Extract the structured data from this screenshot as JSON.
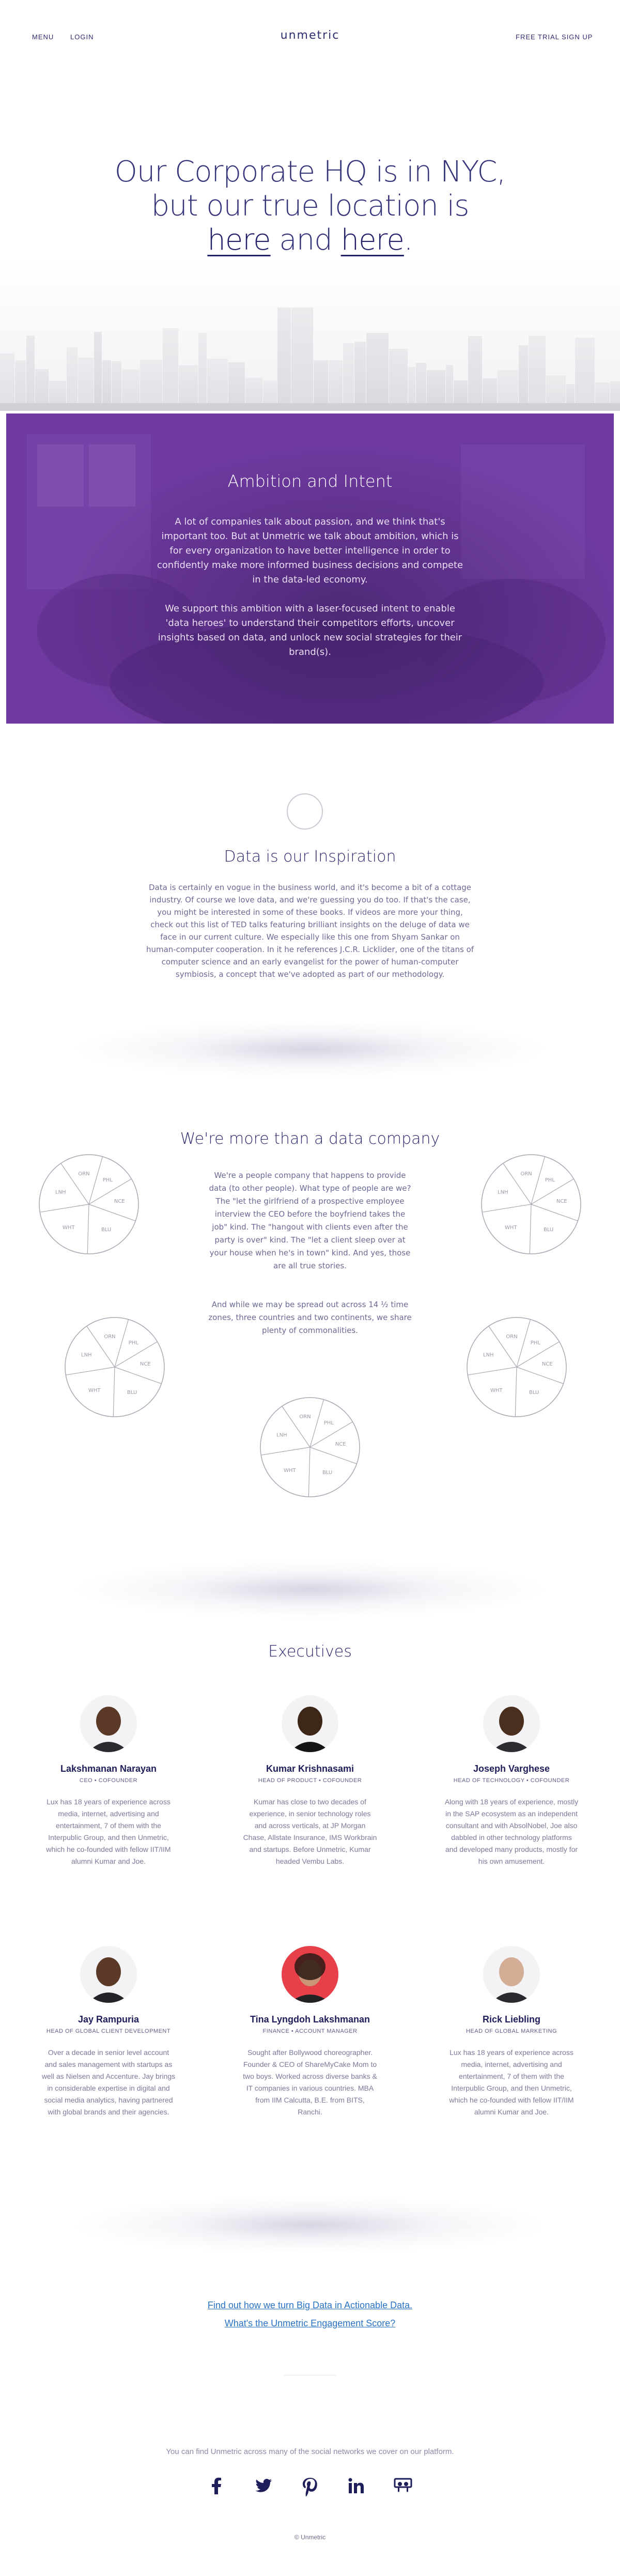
{
  "nav": {
    "menu": "MENU",
    "login": "LOGIN",
    "logo": "unmetric",
    "trial": "FREE TRIAL SIGN UP"
  },
  "hero": {
    "line1": "Our Corporate HQ is in NYC,",
    "line2": "but our true location is",
    "here1": "here",
    "and": "and",
    "here2": "here",
    "period": "."
  },
  "ambition": {
    "title": "Ambition and Intent",
    "p1": "A lot of companies talk about passion, and we think that's important too. But at Unmetric we talk about ambition, which is for every organization to have better intelligence in order to confidently make more informed business decisions and compete in the data-led economy.",
    "p2": "We support this ambition with a laser-focused intent to enable 'data heroes' to understand their competitors efforts, uncover insights based on data, and unlock new social strategies for their brand(s)."
  },
  "inspiration": {
    "title": "Data is our Inspiration",
    "text_a": "Data is certainly en vogue in the business world, and it's become a bit of a cottage industry. Of course we love data, and we're guessing you do too. If that's the case, you might be interested in some of these books. If videos are more your thing, check out this list of TED talks featuring brilliant insights on the deluge of data we face in our current culture. We especially like this one from Shyam Sankar on human-computer cooperation. In it he references J.C.R. Licklider, one of the titans of computer science and an early evangelist for the power of human-computer symbiosis, a concept that we've adopted as part of our methodology."
  },
  "more": {
    "title": "We're more than a data company",
    "p1": "We're a people company that happens to provide data (to other people). What type of people are we? The \"let the girlfriend of a prospective employee interview the CEO before the boyfriend takes the job\" kind. The \"hangout with clients even after the party is over\" kind. The \"let a client sleep over at your house when he's in town\" kind. And yes, those are all true stories.",
    "p2": "And while we may be spread out across 14 ½ time zones, three countries and two continents, we share plenty of commonalities."
  },
  "pie_labels": [
    "ORN",
    "PHL",
    "NCE",
    "BLU",
    "WHT",
    "LNH"
  ],
  "executives": {
    "title": "Executives",
    "people": [
      {
        "name": "Lakshmanan Narayan",
        "role": "CEO • COFOUNDER",
        "bio": "Lux has 18 years of experience across media, internet, advertising and entertainment, 7 of them with the Interpublic Group, and then Unmetric, which he co-founded with fellow IIT/IIM alumni Kumar and Joe."
      },
      {
        "name": "Kumar Krishnasami",
        "role": "HEAD OF PRODUCT • COFOUNDER",
        "bio": "Kumar has close to two decades of experience, in senior technology roles and across verticals, at JP Morgan Chase, Allstate Insurance, IMS Workbrain and startups. Before Unmetric, Kumar headed Vembu Labs."
      },
      {
        "name": "Joseph Varghese",
        "role": "HEAD OF TECHNOLOGY • COFOUNDER",
        "bio": "Along with 18 years of experience, mostly in the SAP ecosystem as an independent consultant and with AbsolNobel, Joe also dabbled in other technology platforms and developed many products, mostly for his own amusement."
      },
      {
        "name": "Jay Rampuria",
        "role": "HEAD OF GLOBAL CLIENT DEVELOPMENT",
        "bio": "Over a decade in senior level account and sales management with startups as well as Nielsen and Accenture. Jay brings in considerable expertise in digital and social media analytics, having partnered with global brands and their agencies."
      },
      {
        "name": "Tina Lyngdoh Lakshmanan",
        "role": "FINANCE • ACCOUNT MANAGER",
        "bio": "Sought after Bollywood choreographer. Founder & CEO of ShareMyCake Mom to two boys. Worked across diverse banks & IT companies in various countries. MBA from IIM Calcutta, B.E. from BITS, Ranchi."
      },
      {
        "name": "Rick Liebling",
        "role": "HEAD OF GLOBAL MARKETING",
        "bio": "Lux has 18 years of experience across media, internet, advertising and entertainment, 7 of them with the Interpublic Group, and then Unmetric, which he co-founded with fellow IIT/IIM alumni Kumar and Joe."
      }
    ]
  },
  "cta": {
    "link1": "Find out how we turn Big Data in Actionable Data.",
    "link2": "What's the Unmetric Engagement Score?"
  },
  "footer": {
    "text": "You can find Unmetric across many of the social networks we cover on our platform.",
    "social": [
      "facebook-icon",
      "twitter-icon",
      "pinterest-icon",
      "linkedin-icon",
      "slideshare-icon"
    ],
    "copyright": "© Unmetric"
  },
  "colors": {
    "brand_navy": "#2c2c6e",
    "ambition_purple": "#6e3aa0",
    "link_blue": "#2a73c4"
  }
}
